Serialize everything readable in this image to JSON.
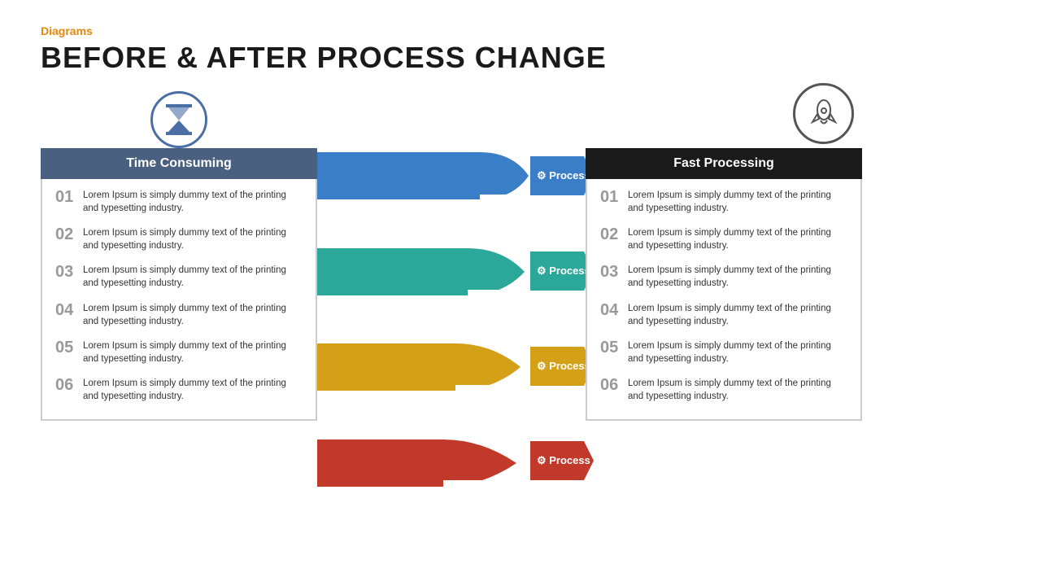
{
  "header": {
    "category": "Diagrams",
    "title": "BEFORE & AFTER PROCESS CHANGE"
  },
  "left_panel": {
    "icon": "⏳",
    "title": "Time Consuming",
    "items": [
      {
        "num": "01",
        "text": "Lorem Ipsum is simply dummy text of the printing and typesetting industry."
      },
      {
        "num": "02",
        "text": "Lorem Ipsum is simply dummy text of the printing and typesetting industry."
      },
      {
        "num": "03",
        "text": "Lorem Ipsum is simply dummy text of the printing and typesetting industry."
      },
      {
        "num": "04",
        "text": "Lorem Ipsum is simply dummy text of the printing and typesetting industry."
      },
      {
        "num": "05",
        "text": "Lorem Ipsum is simply dummy text of the printing and typesetting industry."
      },
      {
        "num": "06",
        "text": "Lorem Ipsum is simply dummy text of the printing and typesetting industry."
      }
    ]
  },
  "processes": [
    {
      "label": "Process",
      "color": "#3b7ec8"
    },
    {
      "label": "Process",
      "color": "#2ca89a"
    },
    {
      "label": "Process",
      "color": "#d4a017"
    },
    {
      "label": "Process",
      "color": "#c0392b"
    }
  ],
  "right_panel": {
    "icon": "🚀",
    "title": "Fast Processing",
    "items": [
      {
        "num": "01",
        "text": "Lorem Ipsum is simply dummy text of the printing and typesetting industry."
      },
      {
        "num": "02",
        "text": "Lorem Ipsum is simply dummy text of the printing and typesetting industry."
      },
      {
        "num": "03",
        "text": "Lorem Ipsum is simply dummy text of the printing and typesetting industry."
      },
      {
        "num": "04",
        "text": "Lorem Ipsum is simply dummy text of the printing and typesetting industry."
      },
      {
        "num": "05",
        "text": "Lorem Ipsum is simply dummy text of the printing and typesetting industry."
      },
      {
        "num": "06",
        "text": "Lorem Ipsum is simply dummy text of the printing and typesetting industry."
      }
    ]
  },
  "colors": {
    "orange": "#e8870a",
    "dark_blue": "#4a6080",
    "blue": "#3b7ec8",
    "teal": "#2ca89a",
    "yellow": "#d4a017",
    "red": "#c0392b",
    "black": "#1a1a1a"
  }
}
